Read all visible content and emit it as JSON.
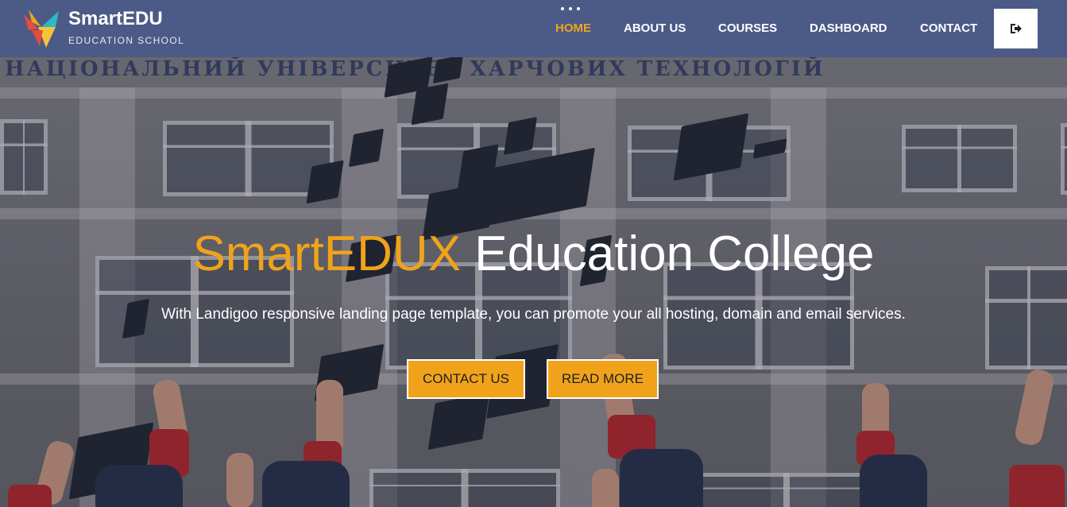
{
  "brand": {
    "name": "SmartEDU",
    "tagline": "EDUCATION SCHOOL"
  },
  "nav": {
    "items": [
      {
        "label": "HOME",
        "active": true
      },
      {
        "label": "ABOUT US",
        "active": false
      },
      {
        "label": "COURSES",
        "active": false
      },
      {
        "label": "DASHBOARD",
        "active": false
      },
      {
        "label": "CONTACT",
        "active": false
      }
    ],
    "login_icon": "sign-out-icon"
  },
  "hero": {
    "sign_text": "НАЦІОНАЛЬНИЙ УНІВЕРСИТЕТ ХАРЧОВИХ ТЕХНОЛОГІЙ",
    "title_accent": "SmartEDUX",
    "title_rest": "Education College",
    "subtitle": "With Landigoo responsive landing page template, you can promote your all hosting, domain and email services.",
    "buttons": [
      {
        "label": "CONTACT US"
      },
      {
        "label": "READ MORE"
      }
    ]
  },
  "colors": {
    "header_bg": "#4c5a87",
    "accent": "#f0a31a",
    "text": "#ffffff"
  }
}
